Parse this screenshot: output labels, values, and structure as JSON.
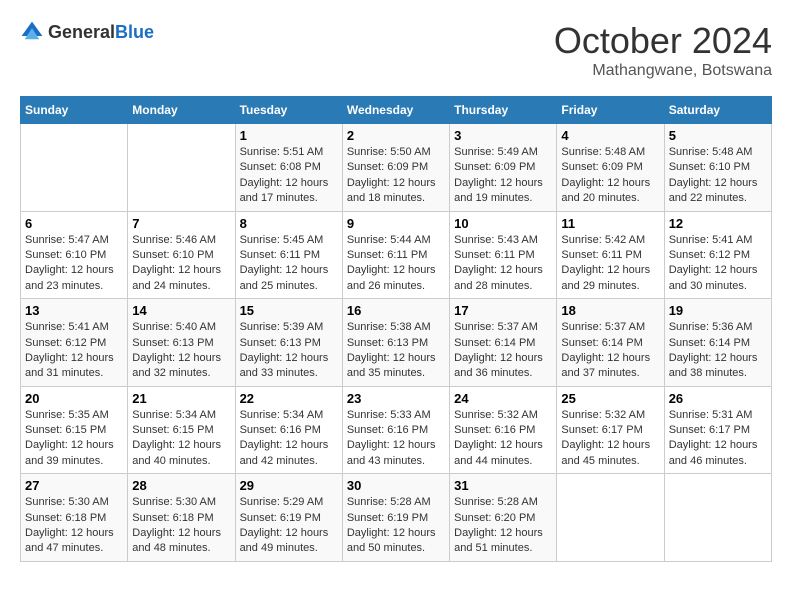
{
  "header": {
    "logo_general": "General",
    "logo_blue": "Blue",
    "title": "October 2024",
    "location": "Mathangwane, Botswana"
  },
  "weekdays": [
    "Sunday",
    "Monday",
    "Tuesday",
    "Wednesday",
    "Thursday",
    "Friday",
    "Saturday"
  ],
  "weeks": [
    [
      {
        "day": "",
        "sunrise": "",
        "sunset": "",
        "daylight": ""
      },
      {
        "day": "",
        "sunrise": "",
        "sunset": "",
        "daylight": ""
      },
      {
        "day": "1",
        "sunrise": "Sunrise: 5:51 AM",
        "sunset": "Sunset: 6:08 PM",
        "daylight": "Daylight: 12 hours and 17 minutes."
      },
      {
        "day": "2",
        "sunrise": "Sunrise: 5:50 AM",
        "sunset": "Sunset: 6:09 PM",
        "daylight": "Daylight: 12 hours and 18 minutes."
      },
      {
        "day": "3",
        "sunrise": "Sunrise: 5:49 AM",
        "sunset": "Sunset: 6:09 PM",
        "daylight": "Daylight: 12 hours and 19 minutes."
      },
      {
        "day": "4",
        "sunrise": "Sunrise: 5:48 AM",
        "sunset": "Sunset: 6:09 PM",
        "daylight": "Daylight: 12 hours and 20 minutes."
      },
      {
        "day": "5",
        "sunrise": "Sunrise: 5:48 AM",
        "sunset": "Sunset: 6:10 PM",
        "daylight": "Daylight: 12 hours and 22 minutes."
      }
    ],
    [
      {
        "day": "6",
        "sunrise": "Sunrise: 5:47 AM",
        "sunset": "Sunset: 6:10 PM",
        "daylight": "Daylight: 12 hours and 23 minutes."
      },
      {
        "day": "7",
        "sunrise": "Sunrise: 5:46 AM",
        "sunset": "Sunset: 6:10 PM",
        "daylight": "Daylight: 12 hours and 24 minutes."
      },
      {
        "day": "8",
        "sunrise": "Sunrise: 5:45 AM",
        "sunset": "Sunset: 6:11 PM",
        "daylight": "Daylight: 12 hours and 25 minutes."
      },
      {
        "day": "9",
        "sunrise": "Sunrise: 5:44 AM",
        "sunset": "Sunset: 6:11 PM",
        "daylight": "Daylight: 12 hours and 26 minutes."
      },
      {
        "day": "10",
        "sunrise": "Sunrise: 5:43 AM",
        "sunset": "Sunset: 6:11 PM",
        "daylight": "Daylight: 12 hours and 28 minutes."
      },
      {
        "day": "11",
        "sunrise": "Sunrise: 5:42 AM",
        "sunset": "Sunset: 6:11 PM",
        "daylight": "Daylight: 12 hours and 29 minutes."
      },
      {
        "day": "12",
        "sunrise": "Sunrise: 5:41 AM",
        "sunset": "Sunset: 6:12 PM",
        "daylight": "Daylight: 12 hours and 30 minutes."
      }
    ],
    [
      {
        "day": "13",
        "sunrise": "Sunrise: 5:41 AM",
        "sunset": "Sunset: 6:12 PM",
        "daylight": "Daylight: 12 hours and 31 minutes."
      },
      {
        "day": "14",
        "sunrise": "Sunrise: 5:40 AM",
        "sunset": "Sunset: 6:13 PM",
        "daylight": "Daylight: 12 hours and 32 minutes."
      },
      {
        "day": "15",
        "sunrise": "Sunrise: 5:39 AM",
        "sunset": "Sunset: 6:13 PM",
        "daylight": "Daylight: 12 hours and 33 minutes."
      },
      {
        "day": "16",
        "sunrise": "Sunrise: 5:38 AM",
        "sunset": "Sunset: 6:13 PM",
        "daylight": "Daylight: 12 hours and 35 minutes."
      },
      {
        "day": "17",
        "sunrise": "Sunrise: 5:37 AM",
        "sunset": "Sunset: 6:14 PM",
        "daylight": "Daylight: 12 hours and 36 minutes."
      },
      {
        "day": "18",
        "sunrise": "Sunrise: 5:37 AM",
        "sunset": "Sunset: 6:14 PM",
        "daylight": "Daylight: 12 hours and 37 minutes."
      },
      {
        "day": "19",
        "sunrise": "Sunrise: 5:36 AM",
        "sunset": "Sunset: 6:14 PM",
        "daylight": "Daylight: 12 hours and 38 minutes."
      }
    ],
    [
      {
        "day": "20",
        "sunrise": "Sunrise: 5:35 AM",
        "sunset": "Sunset: 6:15 PM",
        "daylight": "Daylight: 12 hours and 39 minutes."
      },
      {
        "day": "21",
        "sunrise": "Sunrise: 5:34 AM",
        "sunset": "Sunset: 6:15 PM",
        "daylight": "Daylight: 12 hours and 40 minutes."
      },
      {
        "day": "22",
        "sunrise": "Sunrise: 5:34 AM",
        "sunset": "Sunset: 6:16 PM",
        "daylight": "Daylight: 12 hours and 42 minutes."
      },
      {
        "day": "23",
        "sunrise": "Sunrise: 5:33 AM",
        "sunset": "Sunset: 6:16 PM",
        "daylight": "Daylight: 12 hours and 43 minutes."
      },
      {
        "day": "24",
        "sunrise": "Sunrise: 5:32 AM",
        "sunset": "Sunset: 6:16 PM",
        "daylight": "Daylight: 12 hours and 44 minutes."
      },
      {
        "day": "25",
        "sunrise": "Sunrise: 5:32 AM",
        "sunset": "Sunset: 6:17 PM",
        "daylight": "Daylight: 12 hours and 45 minutes."
      },
      {
        "day": "26",
        "sunrise": "Sunrise: 5:31 AM",
        "sunset": "Sunset: 6:17 PM",
        "daylight": "Daylight: 12 hours and 46 minutes."
      }
    ],
    [
      {
        "day": "27",
        "sunrise": "Sunrise: 5:30 AM",
        "sunset": "Sunset: 6:18 PM",
        "daylight": "Daylight: 12 hours and 47 minutes."
      },
      {
        "day": "28",
        "sunrise": "Sunrise: 5:30 AM",
        "sunset": "Sunset: 6:18 PM",
        "daylight": "Daylight: 12 hours and 48 minutes."
      },
      {
        "day": "29",
        "sunrise": "Sunrise: 5:29 AM",
        "sunset": "Sunset: 6:19 PM",
        "daylight": "Daylight: 12 hours and 49 minutes."
      },
      {
        "day": "30",
        "sunrise": "Sunrise: 5:28 AM",
        "sunset": "Sunset: 6:19 PM",
        "daylight": "Daylight: 12 hours and 50 minutes."
      },
      {
        "day": "31",
        "sunrise": "Sunrise: 5:28 AM",
        "sunset": "Sunset: 6:20 PM",
        "daylight": "Daylight: 12 hours and 51 minutes."
      },
      {
        "day": "",
        "sunrise": "",
        "sunset": "",
        "daylight": ""
      },
      {
        "day": "",
        "sunrise": "",
        "sunset": "",
        "daylight": ""
      }
    ]
  ]
}
